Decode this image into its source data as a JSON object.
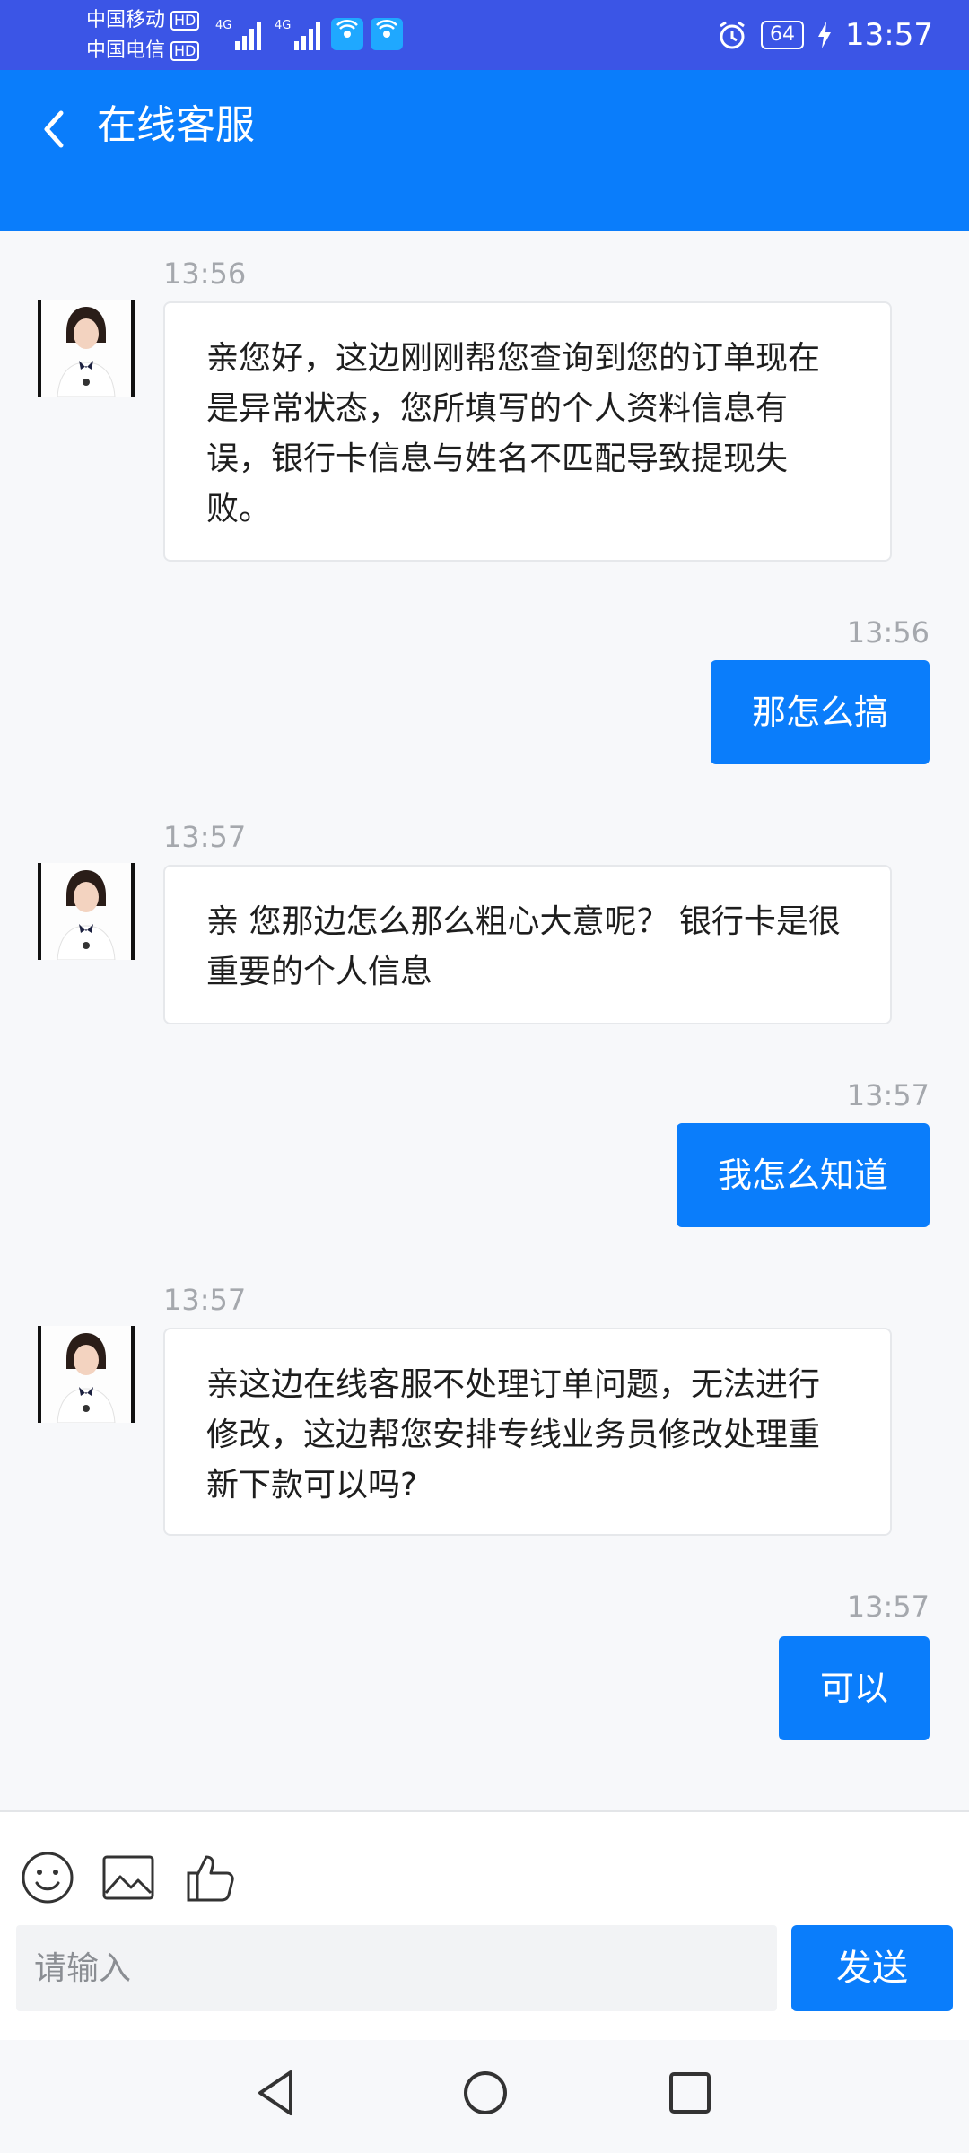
{
  "status_bar": {
    "carrier_1": "中国移动",
    "carrier_2": "中国电信",
    "hd": "HD",
    "net_1": "4G",
    "net_2": "4G",
    "battery": "64",
    "time": "13:57"
  },
  "header": {
    "title": "在线客服",
    "color": "#0a7dfb"
  },
  "messages": [
    {
      "side": "in",
      "time": "13:56",
      "text": "亲您好，这边刚刚帮您查询到您的订单现在是异常状态，您所填写的个人资料信息有误，银行卡信息与姓名不匹配导致提现失败。"
    },
    {
      "side": "out",
      "time": "13:56",
      "text": "那怎么搞"
    },
    {
      "side": "in",
      "time": "13:57",
      "text": "亲 您那边怎么那么粗心大意呢？ 银行卡是很重要的个人信息"
    },
    {
      "side": "out",
      "time": "13:57",
      "text": "我怎么知道"
    },
    {
      "side": "in",
      "time": "13:57",
      "text": "亲这边在线客服不处理订单问题，无法进行修改，这边帮您安排专线业务员修改处理重新下款可以吗?"
    },
    {
      "side": "out",
      "time": "13:57",
      "text": "可以"
    }
  ],
  "toolbar": {
    "icons": [
      "emoji-icon",
      "image-icon",
      "thumbs-up-icon"
    ]
  },
  "input": {
    "placeholder": "请输入",
    "value": ""
  },
  "send_label": "发送",
  "nav_icons": [
    "back-triangle-icon",
    "home-circle-icon",
    "recents-square-icon"
  ]
}
